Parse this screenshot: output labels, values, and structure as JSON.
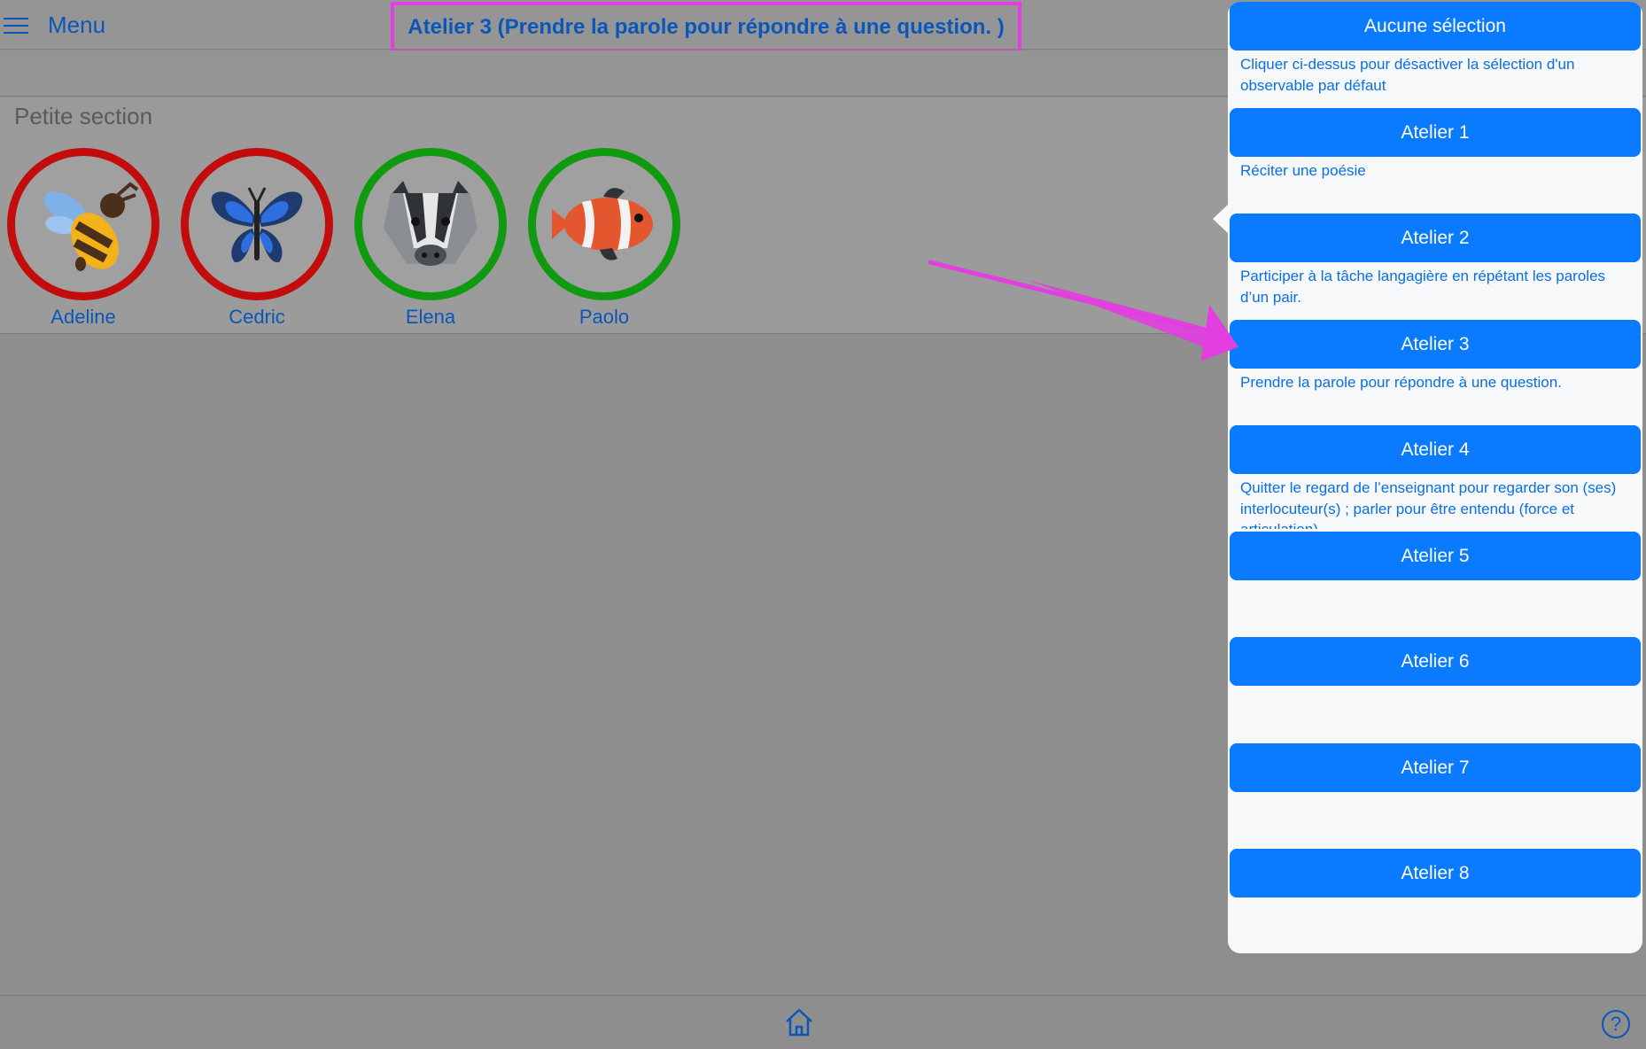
{
  "header": {
    "menu_label": "Menu",
    "title": "Atelier 3 (Prendre la parole pour répondre à une question. )"
  },
  "section": {
    "title": "Petite section"
  },
  "students": [
    {
      "name": "Adeline",
      "icon": "bee-icon",
      "status_color": "#c30d0d"
    },
    {
      "name": "Cedric",
      "icon": "butterfly-icon",
      "status_color": "#c30d0d"
    },
    {
      "name": "Elena",
      "icon": "badger-icon",
      "status_color": "#0f9a0f"
    },
    {
      "name": "Paolo",
      "icon": "clownfish-icon",
      "status_color": "#0f9a0f"
    }
  ],
  "popover": {
    "options": [
      {
        "label": "Aucune sélection",
        "description": "Cliquer ci-dessus pour désactiver la sélection d'un observable par défaut"
      },
      {
        "label": "Atelier 1",
        "description": "Réciter une poésie"
      },
      {
        "label": "Atelier 2",
        "description": "Participer à la tâche langagière en répétant les paroles d’un pair."
      },
      {
        "label": "Atelier 3",
        "description": "Prendre la parole pour répondre à une question."
      },
      {
        "label": "Atelier 4",
        "description": "Quitter le regard de l’enseignant pour regarder son (ses) interlocuteur(s) ; parler pour être entendu (force et articulation)."
      },
      {
        "label": "Atelier 5",
        "description": ""
      },
      {
        "label": "Atelier 6",
        "description": ""
      },
      {
        "label": "Atelier 7",
        "description": ""
      },
      {
        "label": "Atelier 8",
        "description": ""
      }
    ]
  },
  "footer": {
    "home_icon": "home-icon",
    "help_symbol": "?"
  },
  "colors": {
    "accent": "#0a7bff",
    "text_blue": "#0b57b8",
    "highlight": "#e23ee0",
    "red_status": "#c30d0d",
    "green_status": "#0f9a0f"
  }
}
